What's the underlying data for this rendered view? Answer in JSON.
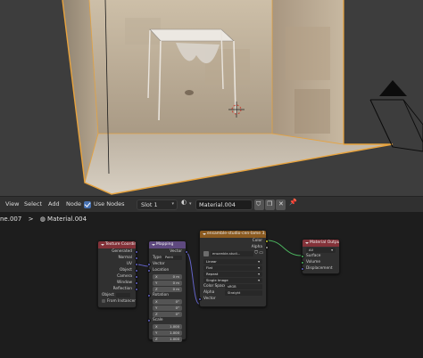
{
  "header": {
    "menu": [
      "View",
      "Select",
      "Add",
      "Node"
    ],
    "use_nodes_label": "Use Nodes",
    "slot_label": "Slot 1",
    "material_name": "Material.004"
  },
  "breadcrumb": {
    "object": "ne.007",
    "separator": ">",
    "material": "Material.004"
  },
  "nodes": {
    "texcoord": {
      "title": "Texture Coordinate",
      "outputs": [
        "Generated",
        "Normal",
        "UV",
        "Object",
        "Camera",
        "Window",
        "Reflection"
      ],
      "object_label": "Object",
      "from_instancer": "From Instancer"
    },
    "mapping": {
      "title": "Mapping",
      "output": "Vector",
      "type_label": "Type",
      "type_value": "Point",
      "input_vector": "Vector",
      "location_label": "Location",
      "location": [
        [
          "X",
          "0 m"
        ],
        [
          "Y",
          "0 m"
        ],
        [
          "Z",
          "0 m"
        ]
      ],
      "rotation_label": "Rotation",
      "rotation": [
        [
          "X",
          "0°"
        ],
        [
          "Y",
          "0°"
        ],
        [
          "Z",
          "0°"
        ]
      ],
      "scale_label": "Scale",
      "scale": [
        [
          "X",
          "1.000"
        ],
        [
          "Y",
          "1.000"
        ],
        [
          "Z",
          "1.000"
        ]
      ]
    },
    "image": {
      "title": "ensamble-studio-cen-lame 3.jpg",
      "out_color": "Color",
      "out_alpha": "Alpha",
      "image_name": "ensamble-studi...",
      "interpolation": "Linear",
      "projection": "Flat",
      "extension": "Repeat",
      "source": "Single Image",
      "color_space_label": "Color Space",
      "color_space": "sRGB",
      "alpha_label": "Alpha",
      "alpha": "Straight",
      "input_vector": "Vector"
    },
    "output": {
      "title": "Material Output",
      "target": "All",
      "inputs": [
        "Surface",
        "Volume",
        "Displacement"
      ]
    }
  },
  "colors": {
    "accent_blue": "#4772b3",
    "texcoord_header": "#833239",
    "mapping_header": "#5e497f",
    "image_header": "#8a5a20",
    "output_header": "#833239",
    "selection_outline": "#e8a33d"
  }
}
